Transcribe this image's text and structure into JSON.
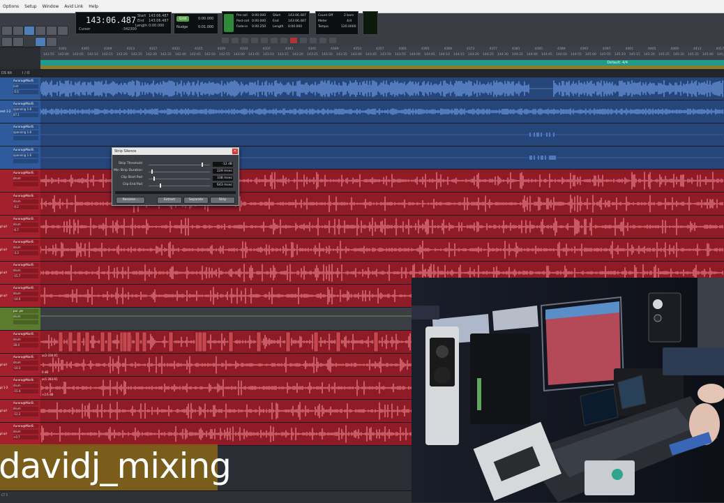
{
  "menu": [
    "Options",
    "Setup",
    "Window",
    "Avid Link",
    "Help"
  ],
  "counter": {
    "main": "143:06.487",
    "labels": [
      "Start",
      "End",
      "Length"
    ],
    "values": [
      "143:06.487",
      "143:06.487",
      "0:00.000"
    ],
    "mode": "Cursor",
    "nudge": "-342300"
  },
  "grid": {
    "mode": "Grid",
    "value": "0:00.000",
    "nudge": "Nudge",
    "nudge_value": "0:01.000"
  },
  "transport": {
    "labels": [
      "Pre-roll",
      "Post-roll",
      "Fade-in"
    ],
    "values": [
      "0:00.000",
      "0:00.000",
      "0:00.250"
    ],
    "r_labels": [
      "Start",
      "End",
      "Length"
    ],
    "r_values": [
      "143:06.487",
      "143:06.487",
      "0:00.000"
    ]
  },
  "count": {
    "off": "Count Off",
    "meter": "Meter",
    "tempo": "Tempo",
    "bars": "2 bars",
    "meter_val": "4/4",
    "tempo_val": "120.0000"
  },
  "ruler": {
    "bars": [
      "4301",
      "4305",
      "4309",
      "4313",
      "4317",
      "4321",
      "4325",
      "4329",
      "4333",
      "4337",
      "4341",
      "4345",
      "4349",
      "4353",
      "4357",
      "4361",
      "4365",
      "4369",
      "4373",
      "4377",
      "4381",
      "4385",
      "4389",
      "4393",
      "4397",
      "4401",
      "4405",
      "4409",
      "4413",
      "4417"
    ],
    "times": [
      "141:55",
      "142:00",
      "142:05",
      "142:10",
      "142:15",
      "142:20",
      "142:25",
      "142:30",
      "142:35",
      "142:40",
      "142:45",
      "142:50",
      "142:55",
      "143:00",
      "143:05",
      "143:10",
      "143:15",
      "143:20",
      "143:25",
      "143:30",
      "143:35",
      "143:40",
      "143:45",
      "143:50",
      "143:55",
      "144:00",
      "144:05",
      "144:10",
      "144:15",
      "144:20",
      "144:25",
      "144:30",
      "144:35",
      "144:40",
      "144:45",
      "144:50",
      "144:55",
      "145:00",
      "145:05",
      "145:10",
      "145:15",
      "145:20",
      "145:25",
      "145:30",
      "145:35",
      "145:40",
      "145:45"
    ],
    "tempo_label": "Default: 4/4"
  },
  "header": {
    "left": "DS Kit",
    "io": "I / O"
  },
  "tracks": [
    {
      "name": "Aurora@MixrB.",
      "sub": "inst",
      "val": "-5.5",
      "color": "#2f5a9c",
      "wave": "#7fb0ff",
      "tag": ""
    },
    {
      "name": "Aurora@MixrB.",
      "sub": "spanning 1-6",
      "val": "47.1",
      "color": "#2f5a9c",
      "wave": "#7fb0ff",
      "tag": "rest 1-2"
    },
    {
      "name": "Aurora@MixrB.",
      "sub": "spanning 1-6",
      "val": "",
      "color": "#2f5a9c",
      "wave": "#7fb0ff",
      "tag": ""
    },
    {
      "name": "Aurora@MixrB.",
      "sub": "spanning 1-6",
      "val": "",
      "color": "#2f5a9c",
      "wave": "#7fb0ff",
      "tag": ""
    },
    {
      "name": "Aurora@MixrB.",
      "sub": "drum",
      "val": "",
      "color": "#a5202d",
      "wave": "#ff9aa3",
      "tag": ""
    },
    {
      "name": "Aurora@MixrB.",
      "sub": "drum",
      "val": "-0.2",
      "color": "#a5202d",
      "wave": "#ff9aa3",
      "tag": ""
    },
    {
      "name": "Aurora@MixrB.",
      "sub": "drum",
      "val": "-6.7",
      "color": "#a5202d",
      "wave": "#ff9aa3",
      "tag": "pl o/r"
    },
    {
      "name": "Aurora@MixrB.",
      "sub": "drum",
      "val": "-3.3",
      "color": "#a5202d",
      "wave": "#ff9aa3",
      "tag": "pl o/r"
    },
    {
      "name": "Aurora@MixrB.",
      "sub": "drum",
      "val": "-15.7",
      "color": "#a5202d",
      "wave": "#ff9aa3",
      "tag": "pl o/r"
    },
    {
      "name": "Aurora@MixrB.",
      "sub": "drum",
      "val": "-14.0",
      "color": "#a5202d",
      "wave": "#ff9aa3",
      "tag": "pl o/r"
    },
    {
      "name": "pu/ .pe",
      "sub": "drum",
      "val": "",
      "color": "#5b7c2c",
      "wave": "#a4d36b",
      "tag": ""
    },
    {
      "name": "Aurora@MixrB.",
      "sub": "drum",
      "val": "18.4",
      "color": "#a5202d",
      "wave": "#ff9aa3",
      "tag": ""
    },
    {
      "name": "Aurora@MixrB.",
      "sub": "drum",
      "val": "-10.3",
      "color": "#a5202d",
      "wave": "#ff9aa3",
      "tag": "pl o/r"
    },
    {
      "name": "Aurora@MixrB.",
      "sub": "drum",
      "val": "-15.4",
      "color": "#a5202d",
      "wave": "#ff9aa3",
      "tag": "pl 1-2"
    },
    {
      "name": "Aurora@MixrB.",
      "sub": "drum",
      "val": "-12.2",
      "color": "#a5202d",
      "wave": "#ff9aa3",
      "tag": "pl o/r"
    },
    {
      "name": "Aurora@MixrB.",
      "sub": "drum",
      "val": "+0.7",
      "color": "#a5202d",
      "wave": "#ff9aa3",
      "tag": "pl o/r"
    }
  ],
  "clip_labels": [
    "ac2-336.R1",
    "0 dB",
    "ac1 283.R1",
    "+2.6 dB"
  ],
  "dialog": {
    "title": "Strip Silence",
    "close": "×",
    "rows": [
      {
        "label": "Strip Threshold",
        "value": "-12 dB",
        "pos": 0.86
      },
      {
        "label": "Min Strip Duration",
        "value": "229 msec",
        "pos": 0.05
      },
      {
        "label": "Clip Start Pad",
        "value": "338 msec",
        "pos": 0.08
      },
      {
        "label": "Clip End Pad",
        "value": "643 msec",
        "pos": 0.18
      }
    ],
    "buttons": [
      "Rename...",
      "Extract",
      "Separate",
      "Strip"
    ]
  },
  "watermark": "davidj_mixing",
  "bottom": "CT 5"
}
